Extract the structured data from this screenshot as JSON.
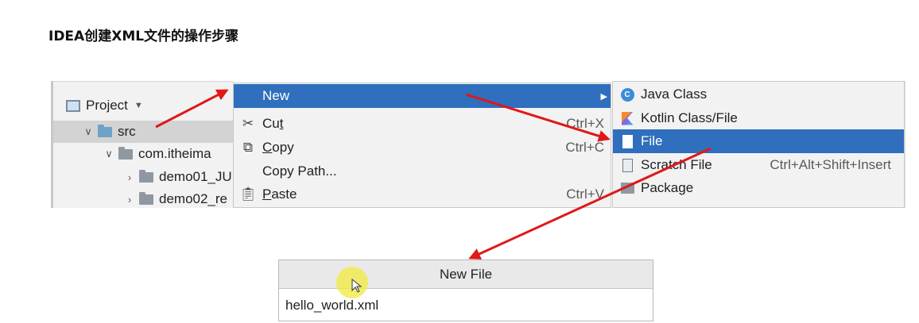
{
  "page": {
    "title": "IDEA创建XML文件的操作步骤"
  },
  "project_tree": {
    "header": "Project",
    "rows": [
      {
        "label": "src"
      },
      {
        "label": "com.itheima"
      },
      {
        "label": "demo01_JU"
      },
      {
        "label": "demo02_re"
      }
    ]
  },
  "context_menu": {
    "items": [
      {
        "label": "New",
        "shortcut": ""
      },
      {
        "label_u": "t",
        "label_pre": "Cu",
        "shortcut": "Ctrl+X"
      },
      {
        "label_u": "C",
        "label_post": "opy",
        "shortcut": "Ctrl+C"
      },
      {
        "label": "Copy Path...",
        "shortcut": ""
      },
      {
        "label_u": "P",
        "label_post": "aste",
        "shortcut": "Ctrl+V"
      }
    ]
  },
  "submenu": {
    "items": [
      {
        "label": "Java Class",
        "shortcut": ""
      },
      {
        "label": "Kotlin Class/File",
        "shortcut": ""
      },
      {
        "label": "File",
        "shortcut": ""
      },
      {
        "label": "Scratch File",
        "shortcut": "Ctrl+Alt+Shift+Insert"
      },
      {
        "label": "Package",
        "shortcut": ""
      }
    ]
  },
  "dialog": {
    "title": "New File",
    "value": "hello_world.xml"
  },
  "colors": {
    "accent": "#2f6fbd",
    "arrow": "#e01818",
    "panel": "#f2f2f2"
  },
  "icons": {
    "project": "project-icon",
    "folder": "folder-icon",
    "cut": "scissors-icon",
    "copy": "copy-icon",
    "paste": "clipboard-icon",
    "java_class": "java-class-icon",
    "kotlin": "kotlin-icon",
    "file": "file-icon",
    "scratch": "scratch-file-icon",
    "package": "package-icon"
  }
}
